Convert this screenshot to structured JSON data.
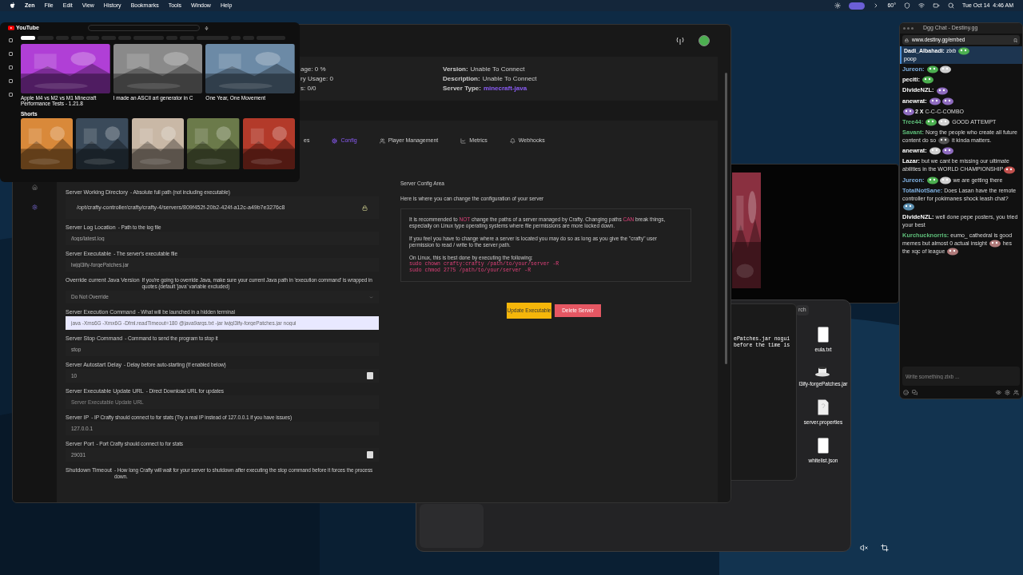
{
  "menubar": {
    "app": "Zen",
    "menus": [
      "File",
      "Edit",
      "View",
      "History",
      "Bookmarks",
      "Tools",
      "Window",
      "Help"
    ],
    "temperature": "60°",
    "clock": "Tue Oct 14  4:46 AM"
  },
  "youtube": {
    "logo": "YouTube",
    "videos": [
      {
        "title": "Apple M4 vs M2 vs M1 Minecraft Performance Tests - 1.21.8"
      },
      {
        "title": "I made an ASCII art generator in C"
      },
      {
        "title": "One Year, One Movement"
      }
    ],
    "shorts_heading": "Shorts"
  },
  "crafty": {
    "stats": [
      "age: 0 %",
      "ry Usage: 0",
      "s: 0/0"
    ],
    "info": [
      {
        "label": "Version:",
        "value": "Unable To Connect",
        "kind": "plain"
      },
      {
        "label": "Description:",
        "value": "Unable To Connect",
        "kind": "plain"
      },
      {
        "label": "Server Type:",
        "value": "minecraft-java",
        "kind": "accent"
      }
    ],
    "tabs": [
      {
        "label": "es",
        "selected": false
      },
      {
        "label": "Config",
        "selected": true
      },
      {
        "label": "Player Management",
        "selected": false
      },
      {
        "label": "Metrics",
        "selected": false
      },
      {
        "label": "Webhooks",
        "selected": false
      }
    ],
    "fields": [
      {
        "label": "Server Working Directory",
        "hint": "- Absolute full path (not including executable)",
        "kind": "locked",
        "value": "/opt/crafty-controller/crafty/crafty-4/servers/809f452f-20b2-424f-a12c-a49b7e3276c8"
      },
      {
        "label": "Server Log Location",
        "hint": "- Path to the log file",
        "kind": "text",
        "value": "/logs/latest.log"
      },
      {
        "label": "Server Executable",
        "hint": "- The server's executable file",
        "kind": "text",
        "value": "lwjgl3ify-forgePatches.jar"
      },
      {
        "label": "Override current Java Version",
        "hint": "If you're going to override Java, make sure your current Java path in 'execution command' is wrapped in quotes (default 'java' variable excluded)",
        "kind": "select",
        "value": "Do Not Override"
      },
      {
        "label": "Server Execution Command",
        "hint": "- What will be launched in a hidden terminal",
        "kind": "focused",
        "value": "java -Xms6G -Xmx6G -Dfml.readTimeout=180 @java9args.txt -jar lwjgl3ify-forgePatches.jar nogui"
      },
      {
        "label": "Server Stop Command",
        "hint": "- Command to send the program to stop it",
        "kind": "text",
        "value": "stop"
      },
      {
        "label": "Server Autostart Delay",
        "hint": "- Delay before auto-starting (If enabled below)",
        "kind": "number",
        "value": "10"
      },
      {
        "label": "Server Executable Update URL",
        "hint": "- Direct Download URL for updates",
        "kind": "text",
        "placeholder": "Server Executable Update URL"
      },
      {
        "label": "Server IP",
        "hint": "- IP Crafty should connect to for stats (Try a real IP instead of 127.0.0.1 if you have issues)",
        "kind": "text",
        "value": "127.0.0.1"
      },
      {
        "label": "Server Port",
        "hint": "- Port Crafty should connect to for stats",
        "kind": "number",
        "value": "29031"
      },
      {
        "label": "Shutdown Timeout",
        "hint": "- How long Crafty will wait for your server to shutdown after executing the  stop command before it forces the process down.",
        "kind": "label"
      }
    ],
    "config_area": {
      "title": "Server Config Area",
      "subtitle": "Here is where you can change the configuration of your server",
      "paragraphs": [
        [
          {
            "kind": "plain",
            "text": "It is recommended to "
          },
          {
            "kind": "warn",
            "text": "NOT"
          },
          {
            "kind": "plain",
            "text": " change the paths of a server managed by Crafty. Changing paths "
          },
          {
            "kind": "warn",
            "text": "CAN"
          },
          {
            "kind": "plain",
            "text": " break things, especially on Linux type operating systems where file permissions are more locked down."
          }
        ],
        [
          {
            "kind": "plain",
            "text": "If you feel you have to change where a server is located you may do so as long as you give the \"crafty\" user permission to read / write to the server path."
          }
        ],
        [
          {
            "kind": "plain",
            "text": "On Linux, this is best done by executing the following:"
          }
        ]
      ],
      "commands": [
        "sudo chown crafty:crafty /path/to/your/server -R",
        "sudo chmod 2775 /path/to/your/server -R"
      ]
    },
    "buttons": [
      {
        "label": "Update Executable",
        "kind": "warning"
      },
      {
        "label": "Delete Server",
        "kind": "danger"
      }
    ]
  },
  "terminal": {
    "lines": [
      "ePatches.jar nogui",
      "before the time is"
    ]
  },
  "finder": {
    "search": "rch",
    "files": [
      {
        "name": "eula.txt",
        "kind": "doc"
      },
      {
        "name": "l3ify-forgePatches.jar",
        "kind": "jar"
      },
      {
        "name": "server.properties",
        "kind": "unknown"
      },
      {
        "name": "whitelist.json",
        "kind": "doc"
      }
    ]
  },
  "chat": {
    "title": "Dgg Chat - Destiny.gg",
    "url": "www.destiny.gg/embed",
    "pinned": {
      "user": "Dadi_Albahadi:",
      "text": "zlxb",
      "body": "poop"
    },
    "messages": [
      {
        "user": "Jureon:",
        "color": "#7fb0e0",
        "parts": [
          {
            "kind": "emote",
            "color": "#4caf50"
          },
          {
            "kind": "emote",
            "color": "#cfcfcf"
          }
        ]
      },
      {
        "user": "peciti:",
        "color": "#ffffff",
        "parts": [
          {
            "kind": "emote",
            "color": "#4caf50"
          }
        ]
      },
      {
        "user": "DivideNZL:",
        "color": "#ffffff",
        "parts": [
          {
            "kind": "emote",
            "color": "#8e6bbf"
          }
        ]
      },
      {
        "user": "anewrat:",
        "color": "#ffffff",
        "parts": [
          {
            "kind": "emote",
            "color": "#8e6bbf"
          },
          {
            "kind": "emote",
            "color": "#8e6bbf"
          }
        ]
      },
      {
        "parts": [
          {
            "kind": "emote",
            "color": "#8e6bbf"
          },
          {
            "kind": "combo",
            "text": "2 X"
          },
          {
            "kind": "text",
            "text": " C-C-C-COMBO"
          }
        ]
      },
      {
        "user": "Tree44:",
        "color": "#5fbf7a",
        "parts": [
          {
            "kind": "emote",
            "color": "#4caf50"
          },
          {
            "kind": "emote",
            "color": "#cfcfcf"
          },
          {
            "kind": "text",
            "text": " GOOD ATTEMPT"
          }
        ]
      },
      {
        "user": "Savant:",
        "color": "#5fbf7a",
        "parts": [
          {
            "kind": "text",
            "text": "Norg the people who create all future content do so "
          },
          {
            "kind": "emote",
            "color": "#555555"
          },
          {
            "kind": "text",
            "text": " it kinda matters."
          }
        ]
      },
      {
        "user": "anewrat:",
        "color": "#ffffff",
        "parts": [
          {
            "kind": "emote",
            "color": "#cfcfcf"
          },
          {
            "kind": "emote",
            "color": "#8e6bbf"
          }
        ]
      },
      {
        "user": "Lazar:",
        "color": "#ffffff",
        "parts": [
          {
            "kind": "text",
            "text": "but we cant be missing our ultimate abilities in the WORLD CHAMPIONSHIP"
          },
          {
            "kind": "emote",
            "color": "#c0504d"
          }
        ]
      },
      {
        "user": "Jureon:",
        "color": "#7fb0e0",
        "parts": [
          {
            "kind": "emote",
            "color": "#4caf50"
          },
          {
            "kind": "emote",
            "color": "#cfcfcf"
          },
          {
            "kind": "text",
            "text": " we are getting there"
          }
        ]
      },
      {
        "user": "TotalNotSane:",
        "color": "#7fb0e0",
        "parts": [
          {
            "kind": "text",
            "text": "Does Lasan have the remote controller for pokimanes shock leash chat?"
          },
          {
            "kind": "emote",
            "color": "#5b8fb0"
          }
        ]
      },
      {
        "user": "DivideNZL:",
        "color": "#ffffff",
        "parts": [
          {
            "kind": "text",
            "text": "well done pepe posters, you tried your best"
          }
        ]
      },
      {
        "user": "Kurchucknorris:",
        "color": "#5fbf7a",
        "parts": [
          {
            "kind": "text",
            "text": "eumo_ cathedral is good memes but almost 0 actual insight "
          },
          {
            "kind": "emote",
            "color": "#b07a7a"
          },
          {
            "kind": "text",
            "text": " hes the xqc of league "
          },
          {
            "kind": "emote",
            "color": "#b07a7a"
          }
        ]
      }
    ],
    "placeholder": "Write something zlxb ..."
  }
}
